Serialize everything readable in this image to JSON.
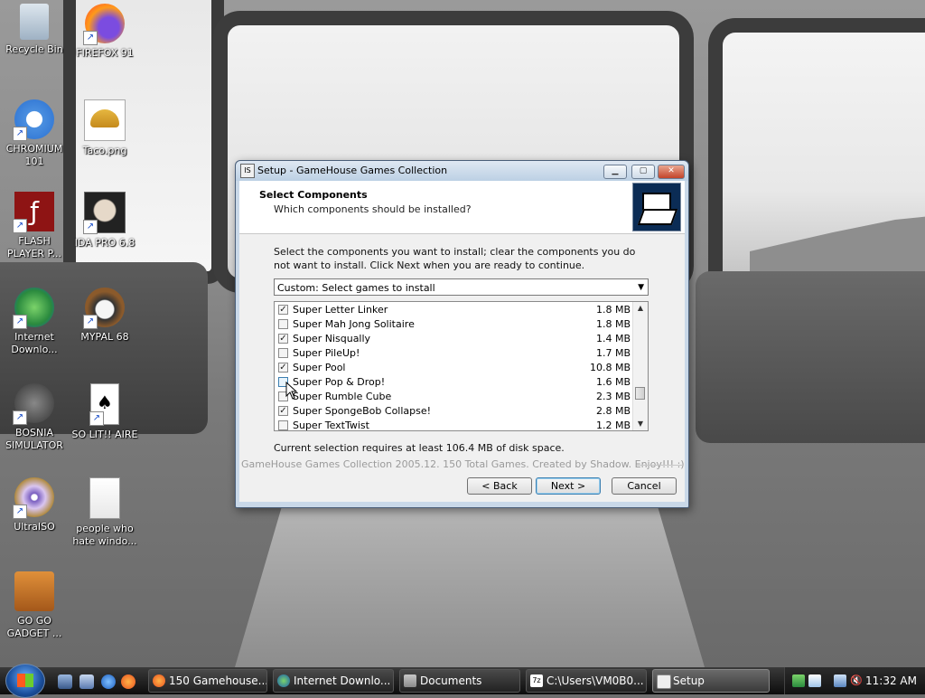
{
  "desktop": {
    "icons": [
      {
        "label": "Recycle Bin",
        "icon": "recycle-bin-icon",
        "shortcut": false
      },
      {
        "label": "FIREFOX 91",
        "icon": "firefox-icon",
        "shortcut": true
      },
      {
        "label": "CHROMIUM 101",
        "icon": "chromium-icon",
        "shortcut": true
      },
      {
        "label": "Taco.png",
        "icon": "taco-image-icon",
        "shortcut": false
      },
      {
        "label": "FLASH PLAYER P...",
        "icon": "flash-player-icon",
        "shortcut": true
      },
      {
        "label": "IDA PRO 6.8",
        "icon": "ida-pro-icon",
        "shortcut": true
      },
      {
        "label": "Internet Downlo...",
        "icon": "internet-download-manager-icon",
        "shortcut": true
      },
      {
        "label": "MYPAL 68",
        "icon": "mypal-icon",
        "shortcut": true
      },
      {
        "label": "BOSNIA SIMULATOR",
        "icon": "bosnia-simulator-icon",
        "shortcut": true
      },
      {
        "label": "SO LIT!! AIRE",
        "icon": "solitaire-cards-icon",
        "shortcut": true
      },
      {
        "label": "UltraISO",
        "icon": "ultraiso-disc-icon",
        "shortcut": true
      },
      {
        "label": "people who hate windo...",
        "icon": "text-document-icon",
        "shortcut": false
      },
      {
        "label": "GO GO GADGET ...",
        "icon": "briefcase-icon",
        "shortcut": false
      }
    ]
  },
  "dialog": {
    "title": "Setup - GameHouse Games Collection",
    "title_icon": "setup-icon",
    "header_title": "Select Components",
    "header_subtitle": "Which components should be installed?",
    "intro": "Select the components you want to install; clear the components you do not want to install. Click Next when you are ready to continue.",
    "combo_value": "Custom: Select games to install",
    "components": [
      {
        "name": "Super Letter Linker",
        "size": "1.8 MB",
        "checked": true
      },
      {
        "name": "Super Mah Jong Solitaire",
        "size": "1.8 MB",
        "checked": false
      },
      {
        "name": "Super Nisqually",
        "size": "1.4 MB",
        "checked": true
      },
      {
        "name": "Super PileUp!",
        "size": "1.7 MB",
        "checked": false
      },
      {
        "name": "Super Pool",
        "size": "10.8 MB",
        "checked": true
      },
      {
        "name": "Super Pop & Drop!",
        "size": "1.6 MB",
        "checked": false
      },
      {
        "name": "Super Rumble Cube",
        "size": "2.3 MB",
        "checked": false
      },
      {
        "name": "Super SpongeBob Collapse!",
        "size": "2.8 MB",
        "checked": true
      },
      {
        "name": "Super TextTwist",
        "size": "1.2 MB",
        "checked": false
      }
    ],
    "disk_space": "Current selection requires at least 106.4 MB of disk space.",
    "branding": "GameHouse Games Collection 2005.12.  150 Total Games.  Created by Shadow.  Enjoy!!! :)",
    "buttons": {
      "back": "< Back",
      "next": "Next >",
      "cancel": "Cancel"
    }
  },
  "taskbar": {
    "tasks": [
      {
        "label": "150 Gamehouse...",
        "icon": "firefox-icon"
      },
      {
        "label": "Internet Downlo...",
        "icon": "internet-download-manager-icon"
      },
      {
        "label": "Documents",
        "icon": "folder-icon"
      },
      {
        "label": "C:\\Users\\VM0B0...",
        "icon": "7zip-icon"
      },
      {
        "label": "Setup",
        "icon": "setup-icon",
        "active": true
      }
    ],
    "clock": "11:32 AM"
  }
}
